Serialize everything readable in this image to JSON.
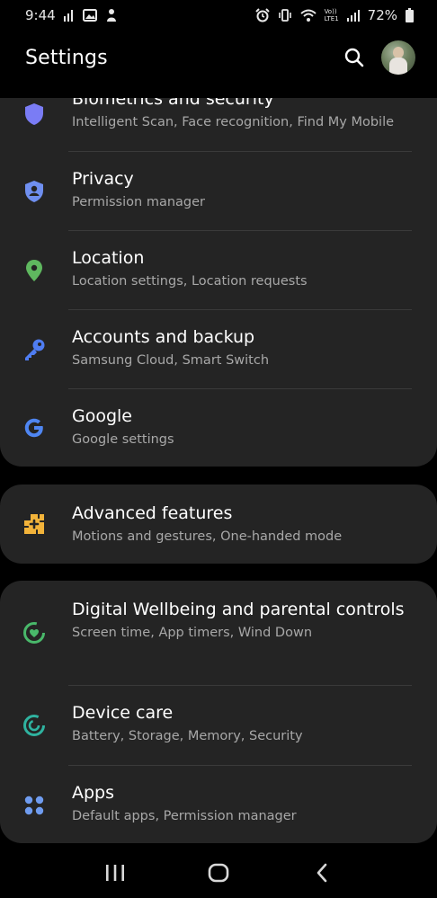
{
  "status_bar": {
    "time": "9:44",
    "battery": "72%",
    "volte_top": "Vo))",
    "volte_bottom": "LTE1"
  },
  "header": {
    "title": "Settings"
  },
  "groups": [
    {
      "items": [
        {
          "title": "Biometrics and security",
          "subtitle": "Intelligent Scan, Face recognition, Find My Mobile",
          "icon": "shield-icon",
          "color": "#7a7cf5"
        },
        {
          "title": "Privacy",
          "subtitle": "Permission manager",
          "icon": "privacy-shield-icon",
          "color": "#6f8ff0"
        },
        {
          "title": "Location",
          "subtitle": "Location settings, Location requests",
          "icon": "location-pin-icon",
          "color": "#5fb85f"
        },
        {
          "title": "Accounts and backup",
          "subtitle": "Samsung Cloud, Smart Switch",
          "icon": "key-icon",
          "color": "#4f7df2"
        },
        {
          "title": "Google",
          "subtitle": "Google settings",
          "icon": "google-icon",
          "color": "#4f86f2"
        }
      ]
    },
    {
      "items": [
        {
          "title": "Advanced features",
          "subtitle": "Motions and gestures, One-handed mode",
          "icon": "puzzle-plus-icon",
          "color": "#f2b33a"
        }
      ]
    },
    {
      "items": [
        {
          "title": "Digital Wellbeing and parental controls",
          "subtitle": "Screen time, App timers, Wind Down",
          "icon": "wellbeing-icon",
          "color": "#49b86a"
        },
        {
          "title": "Device care",
          "subtitle": "Battery, Storage, Memory, Security",
          "icon": "device-care-icon",
          "color": "#2fb3a0"
        },
        {
          "title": "Apps",
          "subtitle": "Default apps, Permission manager",
          "icon": "apps-grid-icon",
          "color": "#6f9cf0"
        }
      ]
    }
  ],
  "nav_bar": {
    "recents": "recent-apps-icon",
    "home": "home-icon",
    "back": "back-icon"
  }
}
